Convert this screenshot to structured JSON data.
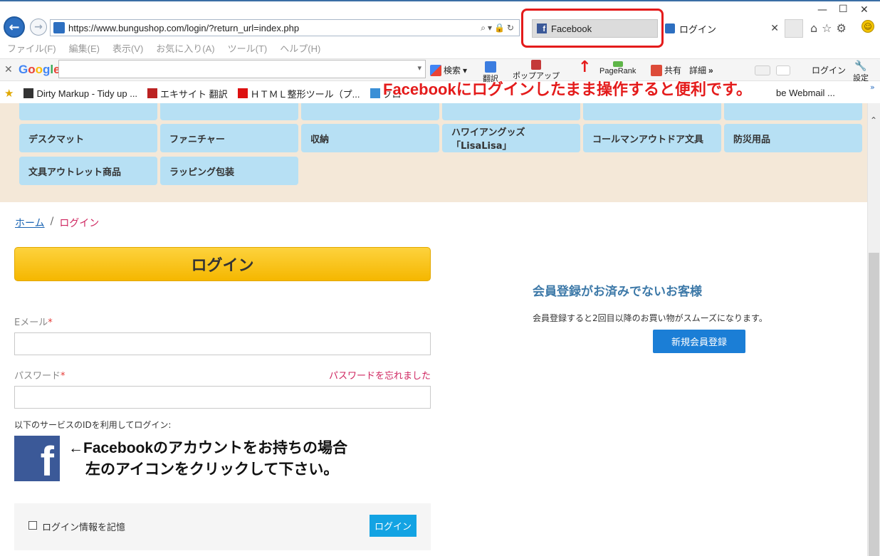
{
  "browser": {
    "url": "https://www.bungushop.com/login/?return_url=index.php",
    "tabs": [
      {
        "label": "Facebook"
      },
      {
        "label": "ログイン"
      }
    ],
    "menu": [
      "ファイル(F)",
      "編集(E)",
      "表示(V)",
      "お気に入り(A)",
      "ツール(T)",
      "ヘルプ(H)"
    ],
    "google_toolbar": {
      "logo": "Google",
      "search_label": "検索",
      "translate_label": "翻訳",
      "popup_label": "ポップアップ",
      "pagerank_label": "PageRank",
      "share_label": "共有",
      "detail_label": "詳細",
      "login_label": "ログイン",
      "settings_label": "設定"
    },
    "favorites": [
      {
        "label": "Dirty Markup - Tidy up ..."
      },
      {
        "label": "エキサイト 翻訳"
      },
      {
        "label": "ＨＴＭＬ整形ツール（プ..."
      },
      {
        "label": "ブロ"
      },
      {
        "label": "be Webmail ..."
      }
    ]
  },
  "annotations": {
    "top": "Facebookにログインしたまま操作すると便利です。",
    "fb_line1": "←Facebookのアカウントをお持ちの場合",
    "fb_line2": "左のアイコンをクリックして下さい。"
  },
  "categories": [
    {
      "label": "デスクマット"
    },
    {
      "label": "ファニチャー"
    },
    {
      "label": "収納"
    },
    {
      "label": "ハワイアングッズ「LisaLisa」"
    },
    {
      "label": "コールマンアウトドア文具"
    },
    {
      "label": "防災用品"
    },
    {
      "label": "文具アウトレット商品"
    },
    {
      "label": "ラッピング包装"
    }
  ],
  "breadcrumb": {
    "home": "ホーム",
    "separator": "/",
    "current": "ログイン"
  },
  "login": {
    "heading": "ログイン",
    "email_label": "Eメール",
    "password_label": "パスワード",
    "required_mark": "*",
    "forgot_link": "パスワードを忘れました",
    "service_label": "以下のサービスのIDを利用してログイン:",
    "fb_icon_letter": "f",
    "remember_label": "ログイン情報を記憶",
    "submit_label": "ログイン"
  },
  "register": {
    "heading": "会員登録がお済みでないお客様",
    "text": "会員登録すると2回目以降のお買い物がスムーズになります。",
    "button": "新規会員登録"
  },
  "colors": {
    "accent_red": "#e41b1b",
    "facebook": "#3b5998",
    "login_gold": "#f5b700",
    "category_blue": "#b7e0f4",
    "register_blue": "#1b7ed6"
  }
}
